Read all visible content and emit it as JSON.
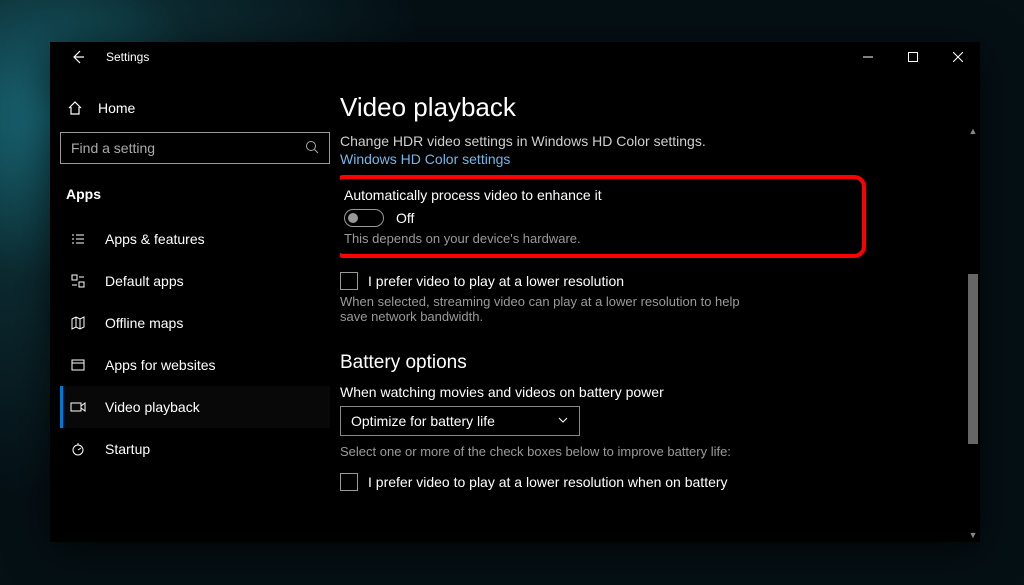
{
  "window": {
    "title": "Settings"
  },
  "sidebar": {
    "home_label": "Home",
    "search_placeholder": "Find a setting",
    "section_label": "Apps",
    "items": [
      {
        "label": "Apps & features"
      },
      {
        "label": "Default apps"
      },
      {
        "label": "Offline maps"
      },
      {
        "label": "Apps for websites"
      },
      {
        "label": "Video playback"
      },
      {
        "label": "Startup"
      }
    ]
  },
  "page": {
    "title": "Video playback",
    "hdr_text": "Change HDR video settings in Windows HD Color settings.",
    "hdr_link": "Windows HD Color settings",
    "auto_enhance": {
      "label": "Automatically process video to enhance it",
      "state": "Off",
      "hint": "This depends on your device's hardware."
    },
    "lower_res": {
      "label": "I prefer video to play at a lower resolution",
      "hint": "When selected, streaming video can play at a lower resolution to help save network bandwidth."
    },
    "battery": {
      "heading": "Battery options",
      "when_label": "When watching movies and videos on battery power",
      "dropdown_value": "Optimize for battery life",
      "improve_text": "Select one or more of the check boxes below to improve battery life:",
      "check_label": "I prefer video to play at a lower resolution when on battery"
    }
  }
}
